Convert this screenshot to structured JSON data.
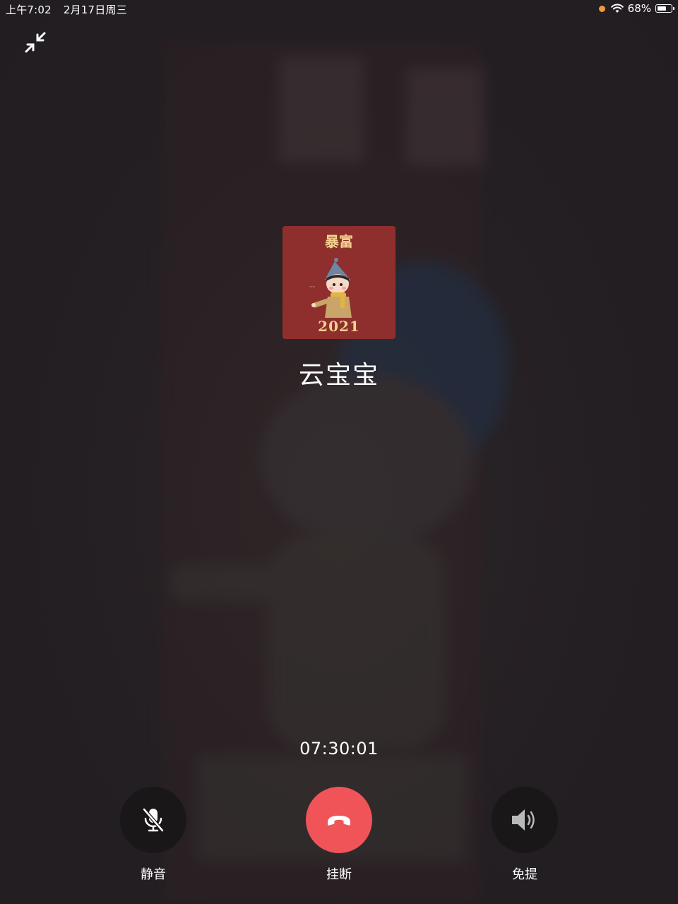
{
  "status_bar": {
    "time": "上午7:02",
    "date": "2月17日周三",
    "battery_percent": "68%",
    "battery_level": 0.68,
    "recording_dot_color": "#f19a38"
  },
  "header": {
    "minimize_icon": "minimize-arrows-icon"
  },
  "contact": {
    "name": "云宝宝",
    "avatar_title": "暴富",
    "avatar_year": "2021"
  },
  "call": {
    "duration": "07:30:01"
  },
  "controls": {
    "mute_label": "静音",
    "mute_icon": "mic-off-icon",
    "hangup_label": "挂断",
    "hangup_icon": "phone-hangup-icon",
    "hangup_color": "#f15458",
    "speaker_label": "免提",
    "speaker_icon": "speaker-icon"
  }
}
